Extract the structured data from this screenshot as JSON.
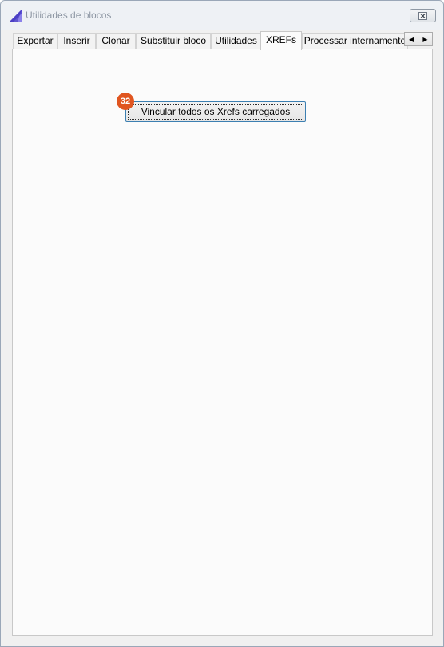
{
  "window": {
    "title": "Utilidades de blocos",
    "icon": "app-sail-icon",
    "close_icon": "close-icon"
  },
  "tabs": [
    {
      "label": "Exportar",
      "active": false
    },
    {
      "label": "Inserir",
      "active": false
    },
    {
      "label": "Clonar",
      "active": false
    },
    {
      "label": "Substituir bloco",
      "active": false
    },
    {
      "label": "Utilidades",
      "active": false
    },
    {
      "label": "XREFs",
      "active": true
    },
    {
      "label": "Processar internamente",
      "active": false
    }
  ],
  "tab_scroll": {
    "left_glyph": "◀",
    "right_glyph": "▶"
  },
  "xrefs_panel": {
    "bind_button_label": "Vincular todos os Xrefs carregados",
    "badge": "32"
  },
  "colors": {
    "accent": "#3c7fb1",
    "badge": "#e05520",
    "title_text": "#8d96a3"
  }
}
